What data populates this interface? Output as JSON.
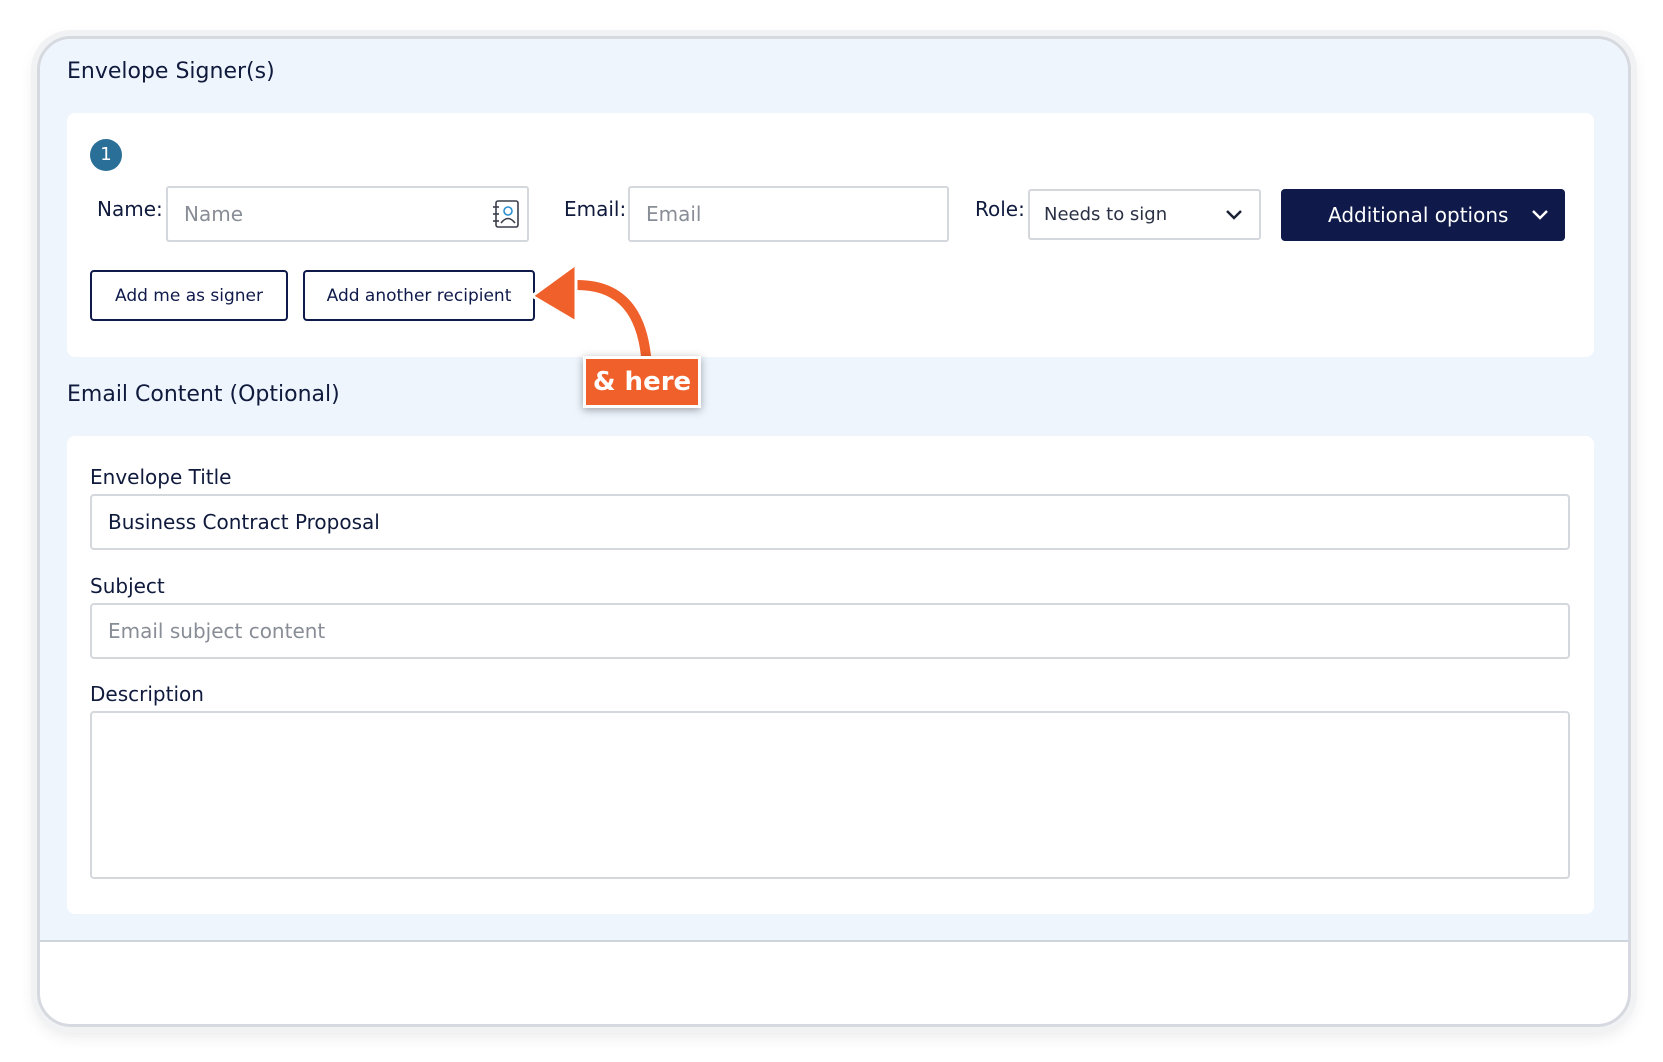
{
  "signers_section": {
    "title": "Envelope Signer(s)",
    "signer_number": "1",
    "name_label": "Name:",
    "name_placeholder": "Name",
    "email_label": "Email:",
    "email_placeholder": "Email",
    "role_label": "Role:",
    "role_value": "Needs to sign",
    "additional_options_label": "Additional options",
    "add_me_label": "Add me as signer",
    "add_recipient_label": "Add another recipient",
    "icons": [
      "contact-book-icon",
      "chevron-down-icon"
    ]
  },
  "callout": {
    "text": "& here",
    "color": "#f0602a"
  },
  "email_section": {
    "title": "Email Content (Optional)",
    "envelope_title_label": "Envelope Title",
    "envelope_title_value": "Business Contract Proposal",
    "subject_label": "Subject",
    "subject_placeholder": "Email subject content",
    "description_label": "Description",
    "description_value": ""
  },
  "colors": {
    "panel_bg": "#eef5fd",
    "primary": "#0f1a4b",
    "badge": "#2a6f97"
  }
}
